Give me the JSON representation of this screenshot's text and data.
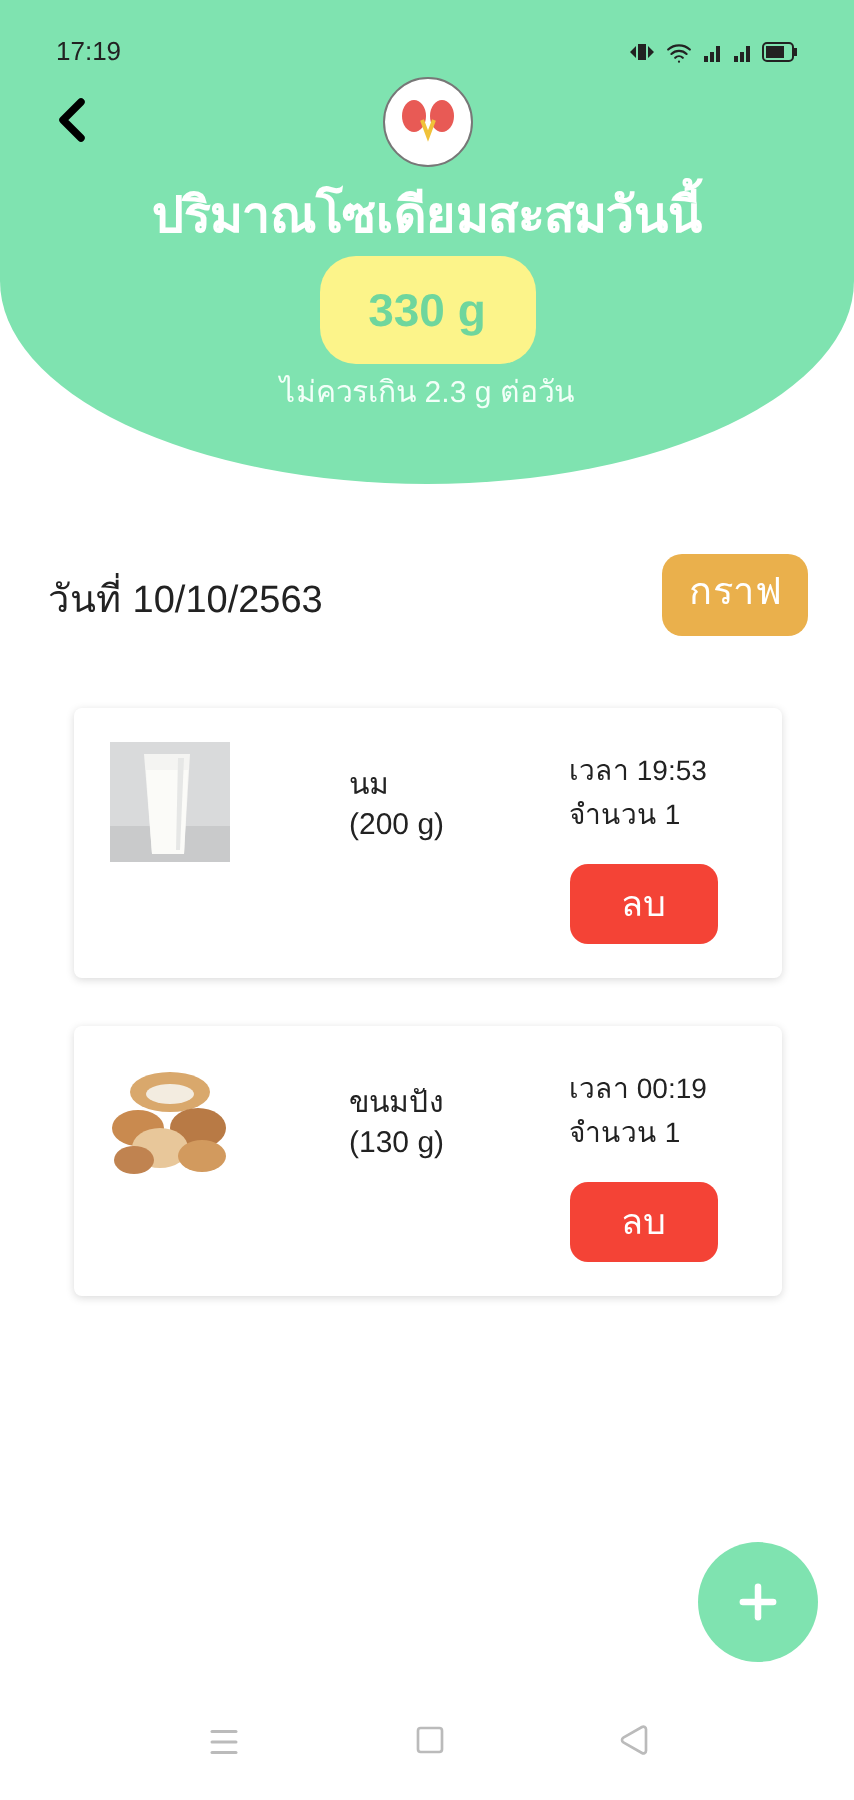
{
  "status_bar": {
    "time": "17:19"
  },
  "header": {
    "title": "ปริมาณโซเดียมสะสมวันนี้",
    "total": "330 g",
    "limit_note": "ไม่ควรเกิน 2.3 g ต่อวัน"
  },
  "date_label": "วันที่ 10/10/2563",
  "graph_button": "กราฟ",
  "entries": [
    {
      "kind": "milk",
      "name": "นม",
      "amount": "(200 g)",
      "time": "เวลา 19:53",
      "quantity": "จำนวน 1",
      "delete_label": "ลบ"
    },
    {
      "kind": "bread",
      "name": "ขนมปัง",
      "amount": "(130 g)",
      "time": "เวลา 00:19",
      "quantity": "จำนวน 1",
      "delete_label": "ลบ"
    }
  ]
}
